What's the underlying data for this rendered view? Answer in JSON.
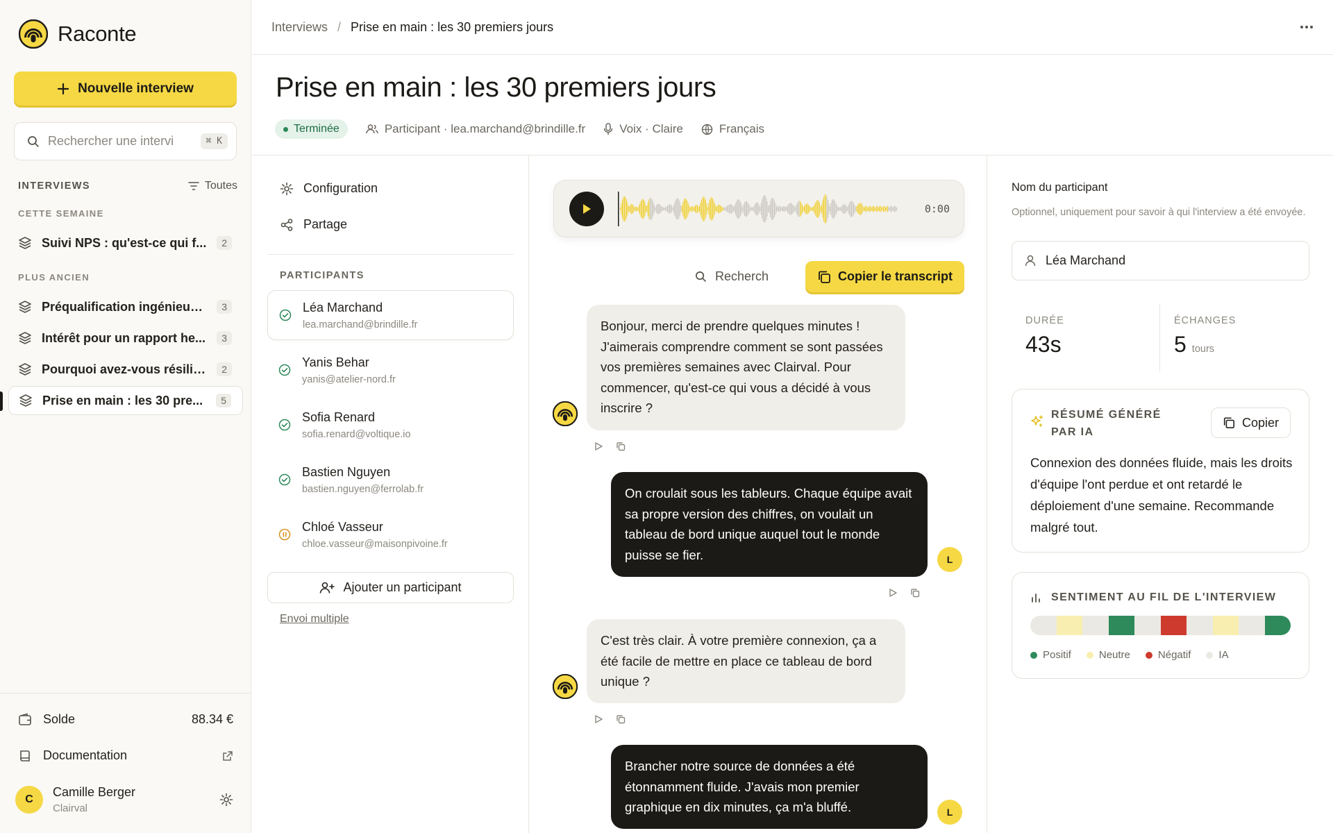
{
  "app": {
    "name": "Raconte"
  },
  "sidebar": {
    "new_button": "Nouvelle interview",
    "search_placeholder": "Rechercher une intervi",
    "shortcut": "⌘ K",
    "section_title": "INTERVIEWS",
    "filter_label": "Toutes",
    "groups": [
      {
        "label": "CETTE SEMAINE",
        "items": [
          {
            "label": "Suivi NPS : qu'est-ce qui f...",
            "count": "2"
          }
        ]
      },
      {
        "label": "PLUS ANCIEN",
        "items": [
          {
            "label": "Préqualification ingénieur ...",
            "count": "3"
          },
          {
            "label": "Intérêt pour un rapport he...",
            "count": "3"
          },
          {
            "label": "Pourquoi avez-vous résilié ?",
            "count": "2"
          },
          {
            "label": "Prise en main : les 30 pre...",
            "count": "5",
            "active": true
          }
        ]
      }
    ],
    "balance_label": "Solde",
    "balance_value": "88.34 €",
    "docs_label": "Documentation",
    "user": {
      "initial": "C",
      "name": "Camille Berger",
      "org": "Clairval"
    }
  },
  "topbar": {
    "crumb_parent": "Interviews",
    "crumb_sep": "/",
    "crumb_current": "Prise en main : les 30 premiers jours"
  },
  "page": {
    "title": "Prise en main : les 30 premiers jours",
    "status": "Terminée",
    "participant": "Participant · lea.marchand@brindille.fr",
    "voice": "Voix · Claire",
    "language": "Français"
  },
  "config": {
    "links": [
      "Configuration",
      "Partage"
    ],
    "participants_title": "PARTICIPANTS",
    "participants": [
      {
        "name": "Léa Marchand",
        "email": "lea.marchand@brindille.fr",
        "status": "done"
      },
      {
        "name": "Yanis Behar",
        "email": "yanis@atelier-nord.fr",
        "status": "done"
      },
      {
        "name": "Sofia Renard",
        "email": "sofia.renard@voltique.io",
        "status": "done"
      },
      {
        "name": "Bastien Nguyen",
        "email": "bastien.nguyen@ferrolab.fr",
        "status": "done"
      },
      {
        "name": "Chloé Vasseur",
        "email": "chloe.vasseur@maisonpivoine.fr",
        "status": "paused"
      }
    ],
    "add_button": "Ajouter un participant",
    "bulk_link": "Envoi multiple"
  },
  "transcript": {
    "time": "0:00",
    "search_placeholder": "Recherch",
    "copy_button": "Copier le transcript",
    "user_initial": "L",
    "messages": [
      {
        "role": "ai",
        "text": "Bonjour, merci de prendre quelques minutes ! J'aimerais comprendre comment se sont passées vos premières semaines avec Clairval. Pour commencer, qu'est-ce qui vous a décidé à vous inscrire ?"
      },
      {
        "role": "user",
        "text": "On croulait sous les tableurs. Chaque équipe avait sa propre version des chiffres, on voulait un tableau de bord unique auquel tout le monde puisse se fier."
      },
      {
        "role": "ai",
        "text": "C'est très clair. À votre première connexion, ça a été facile de mettre en place ce tableau de bord unique ?"
      },
      {
        "role": "user",
        "text": "Brancher notre source de données a été étonnamment fluide. J'avais mon premier graphique en dix minutes, ça m'a bluffé."
      }
    ]
  },
  "details": {
    "name_label": "Nom du participant",
    "name_help": "Optionnel, uniquement pour savoir à qui l'interview a été envoyée.",
    "name_value": "Léa Marchand",
    "duration_label": "DURÉE",
    "duration_value": "43s",
    "exchanges_label": "ÉCHANGES",
    "exchanges_value": "5",
    "exchanges_unit": "tours",
    "summary_title": "RÉSUMÉ GÉNÉRÉ PAR IA",
    "summary_copy": "Copier",
    "summary_text": "Connexion des données fluide, mais les droits d'équipe l'ont perdue et ont retardé le déploiement d'une semaine. Recommande malgré tout.",
    "sentiment_title": "SENTIMENT AU FIL DE L'INTERVIEW",
    "sentiment_segments": [
      "ai",
      "neutral",
      "ai",
      "positive",
      "ai",
      "negative",
      "ai",
      "neutral",
      "ai",
      "positive"
    ],
    "legend": [
      {
        "key": "positive",
        "label": "Positif"
      },
      {
        "key": "neutral",
        "label": "Neutre"
      },
      {
        "key": "negative",
        "label": "Négatif"
      },
      {
        "key": "ai",
        "label": "IA"
      }
    ],
    "colors": {
      "positive": "#2e8a5b",
      "neutral": "#f8eeb0",
      "negative": "#cf3a2e",
      "ai": "#ebe9e3"
    }
  },
  "colors": {
    "accent": "#f5d844",
    "dark": "#1c1a16"
  }
}
